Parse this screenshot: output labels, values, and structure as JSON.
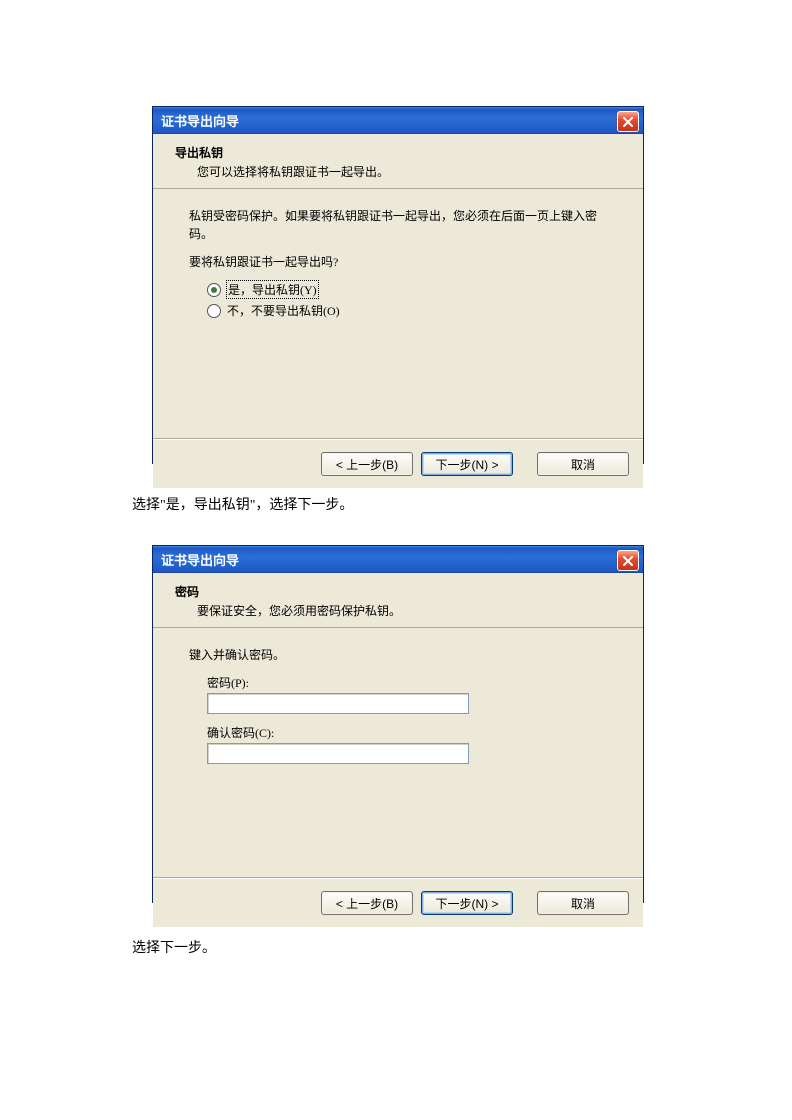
{
  "dialog1": {
    "title": "证书导出向导",
    "close_name": "close",
    "header_title": "导出私钥",
    "header_sub": "您可以选择将私钥跟证书一起导出。",
    "info_text": "私钥受密码保护。如果要将私钥跟证书一起导出，您必须在后面一页上键入密码。",
    "question": "要将私钥跟证书一起导出吗?",
    "radio_yes": "是，导出私钥(Y)",
    "radio_no": "不，不要导出私钥(O)",
    "btn_back": "< 上一步(B)",
    "btn_next": "下一步(N) >",
    "btn_cancel": "取消"
  },
  "caption1": "选择\"是，导出私钥\"，选择下一步。",
  "dialog2": {
    "title": "证书导出向导",
    "close_name": "close",
    "header_title": "密码",
    "header_sub": "要保证安全，您必须用密码保护私钥。",
    "prompt": "键入并确认密码。",
    "password_label": "密码(P):",
    "confirm_label": "确认密码(C):",
    "btn_back": "< 上一步(B)",
    "btn_next": "下一步(N) >",
    "btn_cancel": "取消"
  },
  "caption2": "选择下一步。"
}
